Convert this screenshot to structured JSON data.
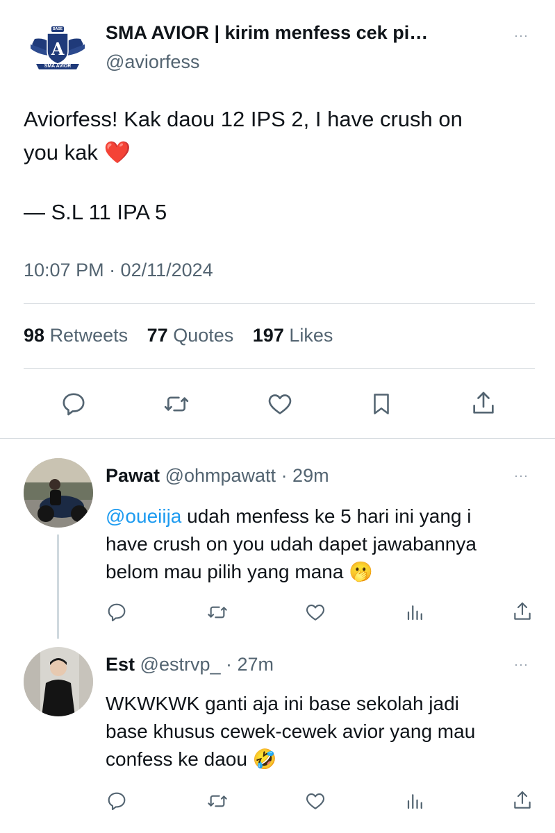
{
  "tweet": {
    "account": {
      "name": "SMA AVIOR | kirim menfess cek pi…",
      "handle": "@aviorfess",
      "logo_text": "SMA AVIOR",
      "logo_sub": "BASE"
    },
    "text_line1": "Aviorfess! Kak daou 12 IPS 2, I have crush on",
    "text_line2": "you kak",
    "heart_emoji": "❤️",
    "signature": "— S.L 11 IPA 5",
    "timestamp": "10:07 PM · 02/11/2024",
    "stats": {
      "retweets_count": "98",
      "retweets_label": "Retweets",
      "quotes_count": "77",
      "quotes_label": "Quotes",
      "likes_count": "197",
      "likes_label": "Likes"
    },
    "actions": [
      "reply-icon",
      "retweet-icon",
      "like-icon",
      "bookmark-icon",
      "share-icon"
    ]
  },
  "replies": [
    {
      "name": "Pawat",
      "handle": "@ohmpawatt",
      "time": "· 29m",
      "mention": "@oueiija",
      "line1_rest": " udah menfess ke 5 hari ini yang i",
      "line2": "have crush on you udah dapet jawabannya",
      "line3": "belom mau pilih yang mana",
      "emoji": "🫢"
    },
    {
      "name": "Est",
      "handle": "@estrvp_",
      "time": "· 27m",
      "line1": "WKWKWK ganti aja ini base sekolah jadi",
      "line2": "base khusus cewek-cewek avior yang mau",
      "line3": "confess ke daou",
      "emoji": "🤣"
    }
  ],
  "more_label": "···",
  "colors": {
    "text": "#0f1419",
    "secondary": "#536471",
    "link": "#1d9bf0",
    "divider": "#d5dade",
    "logo_navy": "#1f3a7a"
  }
}
